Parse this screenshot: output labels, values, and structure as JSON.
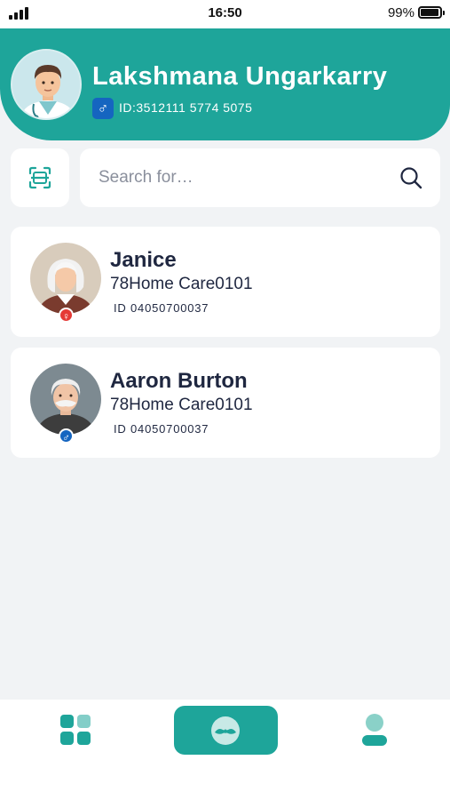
{
  "status_bar": {
    "time": "16:50",
    "battery": "99%"
  },
  "header": {
    "doctor_name": "Lakshmana Ungarkarry",
    "gender_symbol": "♂",
    "doctor_id": "ID:3512111 5774 5075"
  },
  "search": {
    "placeholder": "Search for…"
  },
  "patients": [
    {
      "name": "Janice",
      "location": "78Home Care0101",
      "id": "ID 04050700037",
      "gender_symbol": "♀"
    },
    {
      "name": "Aaron Burton",
      "location": "78Home Care0101",
      "id": "ID 04050700037",
      "gender_symbol": "♂"
    }
  ],
  "bottom_nav": {
    "items": [
      "dashboard-icon",
      "mustache-icon",
      "profile-icon"
    ]
  },
  "colors": {
    "accent": "#1ea59a",
    "male": "#1565c0",
    "female": "#e53935",
    "background": "#f1f3f5"
  }
}
